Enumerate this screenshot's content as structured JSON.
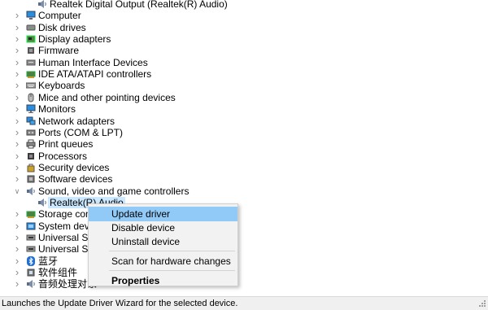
{
  "tree": {
    "items": [
      {
        "label": "Realtek Digital Output (Realtek(R) Audio)",
        "icon": "speaker-icon",
        "expanded": null
      },
      {
        "label": "Computer",
        "icon": "computer-icon",
        "expanded": false
      },
      {
        "label": "Disk drives",
        "icon": "disk-drive-icon",
        "expanded": false
      },
      {
        "label": "Display adapters",
        "icon": "display-adapter-icon",
        "expanded": false
      },
      {
        "label": "Firmware",
        "icon": "firmware-icon",
        "expanded": false
      },
      {
        "label": "Human Interface Devices",
        "icon": "hid-icon",
        "expanded": false
      },
      {
        "label": "IDE ATA/ATAPI controllers",
        "icon": "ide-controller-icon",
        "expanded": false
      },
      {
        "label": "Keyboards",
        "icon": "keyboard-icon",
        "expanded": false
      },
      {
        "label": "Mice and other pointing devices",
        "icon": "mouse-icon",
        "expanded": false
      },
      {
        "label": "Monitors",
        "icon": "monitor-icon",
        "expanded": false
      },
      {
        "label": "Network adapters",
        "icon": "network-adapter-icon",
        "expanded": false
      },
      {
        "label": "Ports (COM & LPT)",
        "icon": "port-icon",
        "expanded": false
      },
      {
        "label": "Print queues",
        "icon": "printer-icon",
        "expanded": false
      },
      {
        "label": "Processors",
        "icon": "processor-icon",
        "expanded": false
      },
      {
        "label": "Security devices",
        "icon": "security-device-icon",
        "expanded": false
      },
      {
        "label": "Software devices",
        "icon": "software-device-icon",
        "expanded": false
      },
      {
        "label": "Sound, video and game controllers",
        "icon": "sound-controller-icon",
        "expanded": true
      },
      {
        "label": "Realtek(R) Audio",
        "icon": "speaker-icon",
        "expanded": null,
        "selected": true
      },
      {
        "label": "Storage contro",
        "icon": "storage-controller-icon",
        "expanded": false
      },
      {
        "label": "System devices",
        "icon": "system-device-icon",
        "expanded": false
      },
      {
        "label": "Universal Seria",
        "icon": "usb-controller-icon",
        "expanded": false
      },
      {
        "label": "Universal Seria",
        "icon": "usb-controller-icon",
        "expanded": false
      },
      {
        "label": "蓝牙",
        "icon": "bluetooth-icon",
        "expanded": false
      },
      {
        "label": "软件组件",
        "icon": "software-component-icon",
        "expanded": false
      },
      {
        "label": "音频处理对象",
        "icon": "audio-processing-icon",
        "expanded": false
      }
    ]
  },
  "context_menu": {
    "items": [
      {
        "label": "Update driver",
        "highlighted": true,
        "bold": false
      },
      {
        "label": "Disable device",
        "highlighted": false,
        "bold": false
      },
      {
        "label": "Uninstall device",
        "highlighted": false,
        "bold": false
      },
      {
        "separator": true
      },
      {
        "label": "Scan for hardware changes",
        "highlighted": false,
        "bold": false
      },
      {
        "separator": true
      },
      {
        "label": "Properties",
        "highlighted": false,
        "bold": true
      }
    ]
  },
  "status_bar": {
    "text": "Launches the Update Driver Wizard for the selected device."
  },
  "colors": {
    "selection": "#cce8ff",
    "menu_highlight": "#91c9f7",
    "menu_background": "#f2f2f2"
  }
}
